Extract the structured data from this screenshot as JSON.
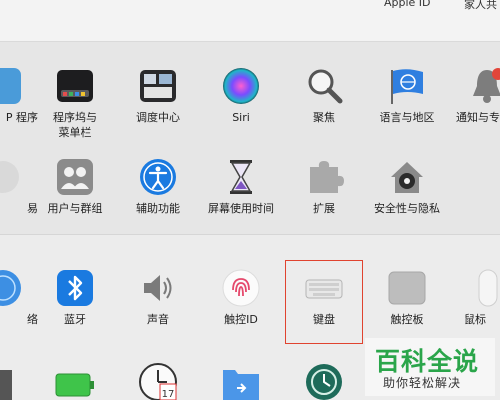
{
  "topbar": {
    "apple_id": "Apple ID",
    "family": "家人共"
  },
  "row1": {
    "partial_left": "P 程序",
    "dock": "程序坞与\n菜单栏",
    "mission": "调度中心",
    "siri": "Siri",
    "spotlight": "聚焦",
    "language": "语言与地区",
    "notifications": "通知与专"
  },
  "row2": {
    "partial_left": "易",
    "users": "用户与群组",
    "accessibility": "辅助功能",
    "screentime": "屏幕使用时间",
    "extensions": "扩展",
    "security": "安全性与隐私"
  },
  "row3": {
    "partial_left": "络",
    "bluetooth": "蓝牙",
    "sound": "声音",
    "touchid": "触控ID",
    "keyboard": "键盘",
    "trackpad": "触控板",
    "mouse": "鼠标"
  },
  "date_badge": "17",
  "watermark": {
    "title": "百科全说",
    "subtitle": "助你轻松解决"
  },
  "colors": {
    "highlight": "#e0432f",
    "watermark_green": "#2aa54a"
  }
}
